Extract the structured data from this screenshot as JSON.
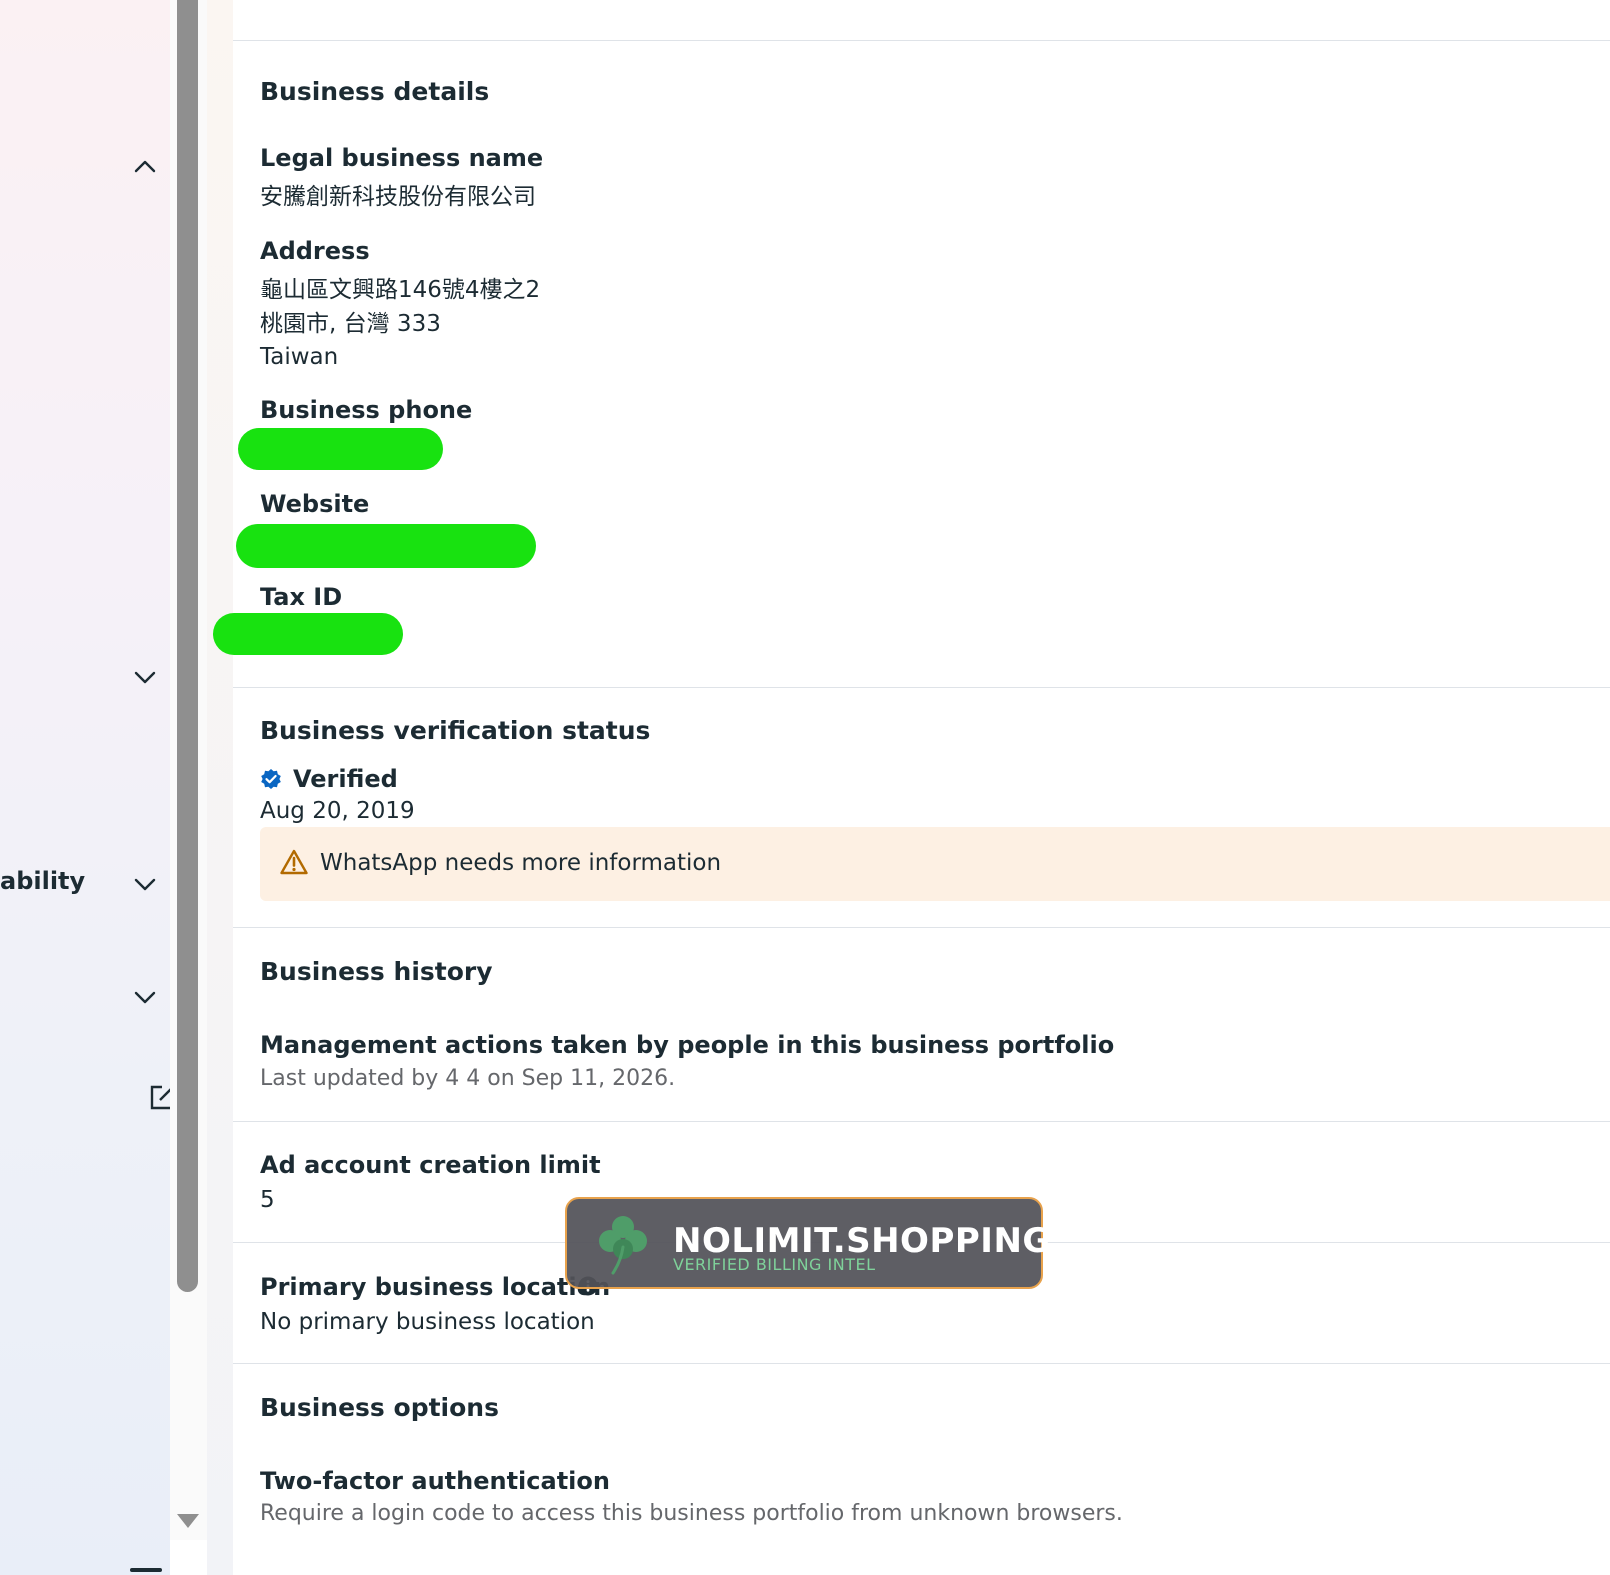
{
  "sidebar": {
    "visible_label": "ability"
  },
  "business_details": {
    "heading": "Business details",
    "legal_name_label": "Legal business name",
    "legal_name_value": "安騰創新科技股份有限公司",
    "address_label": "Address",
    "address_lines": [
      "龜山區文興路146號4樓之2",
      "桃園市, 台灣 333",
      "Taiwan"
    ],
    "phone_label": "Business phone",
    "website_label": "Website",
    "tax_id_label": "Tax ID"
  },
  "verification": {
    "heading": "Business verification status",
    "status": "Verified",
    "date": "Aug 20, 2019",
    "warning": "WhatsApp needs more information"
  },
  "history": {
    "heading": "Business history",
    "title": "Management actions taken by people in this business portfolio",
    "subtitle": "Last updated by 4 4 on Sep 11, 2026."
  },
  "ad_limit": {
    "label": "Ad account creation limit",
    "value": "5"
  },
  "primary_location": {
    "label": "Primary business location",
    "value": "No primary business location"
  },
  "options": {
    "heading": "Business options",
    "two_factor_label": "Two-factor authentication",
    "two_factor_desc": "Require a login code to access this business portfolio from unknown browsers."
  },
  "watermark": {
    "title": "NOLIMIT.SHOPPING",
    "subtitle": "VERIFIED BILLING INTEL"
  },
  "colors": {
    "verified_blue": "#0a66c2",
    "warning_bg": "#fdf0e3",
    "warning_icon": "#b26a00",
    "redaction_green": "#18e210"
  }
}
